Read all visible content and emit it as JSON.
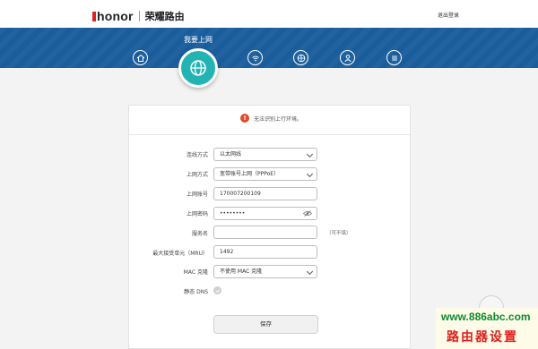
{
  "header": {
    "brand": "honor",
    "product": "荣耀路由",
    "logout": "退出登录"
  },
  "nav": {
    "title": "我要上网",
    "items": [
      {
        "icon": "home-icon"
      },
      {
        "icon": "globe-icon"
      },
      {
        "icon": "wifi-icon"
      },
      {
        "icon": "network-icon"
      },
      {
        "icon": "user-icon"
      },
      {
        "icon": "menu-icon"
      }
    ],
    "active_color": "#24b3b3",
    "band_color": "#1a5d9c"
  },
  "alert": {
    "icon": "!",
    "text": "无法识别上行环境。"
  },
  "form": {
    "connection_type": {
      "label": "连线方式",
      "value": "以太网线"
    },
    "internet_mode": {
      "label": "上网方式",
      "value": "宽带账号上网（PPPoE）"
    },
    "account": {
      "label": "上网账号",
      "value": "170007200109"
    },
    "password": {
      "label": "上网密码",
      "value": "••••••••"
    },
    "service_name": {
      "label": "服务名",
      "value": "",
      "hint": "（可不填）"
    },
    "mru": {
      "label": "最大接受单元（MRU）",
      "value": "1492"
    },
    "mac_clone": {
      "label": "MAC 克隆",
      "value": "不使用 MAC 克隆"
    },
    "static_dns": {
      "label": "静态 DNS"
    },
    "save": "保存"
  },
  "watermark": {
    "url": "www.886abc.com",
    "text": "路由器设置"
  }
}
